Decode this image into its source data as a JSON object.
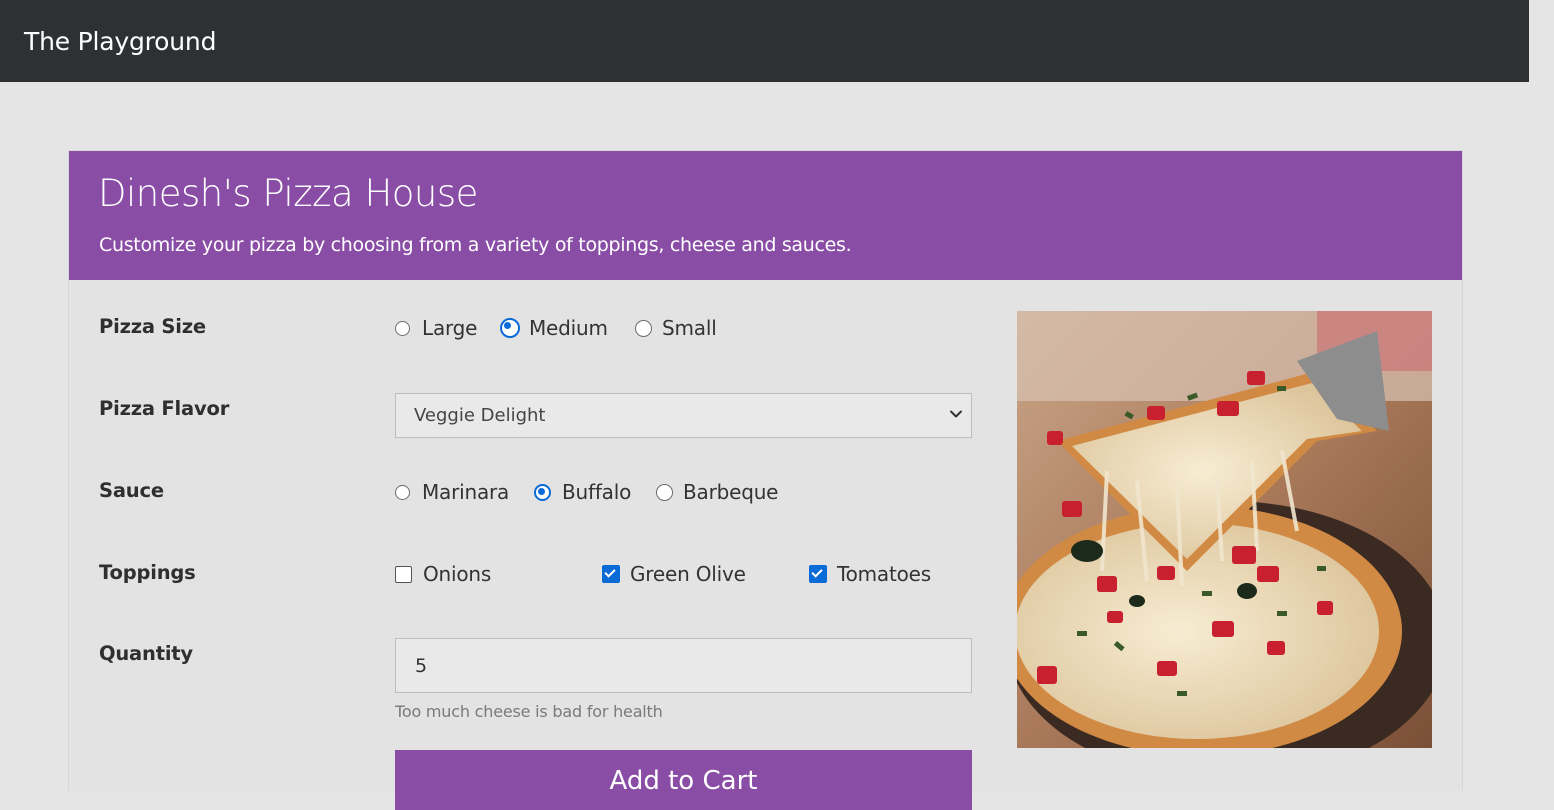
{
  "app": {
    "brand": "The Playground"
  },
  "header": {
    "title": "Dinesh's Pizza House",
    "subtitle": "Customize your pizza by choosing from a variety of toppings, cheese and sauces."
  },
  "form": {
    "size": {
      "label": "Pizza Size",
      "options": [
        {
          "label": "Large",
          "selected": false
        },
        {
          "label": "Medium",
          "selected": true
        },
        {
          "label": "Small",
          "selected": false
        }
      ]
    },
    "flavor": {
      "label": "Pizza Flavor",
      "value": "Veggie Delight"
    },
    "sauce": {
      "label": "Sauce",
      "options": [
        {
          "label": "Marinara",
          "selected": false
        },
        {
          "label": "Buffalo",
          "selected": true
        },
        {
          "label": "Barbeque",
          "selected": false
        }
      ]
    },
    "toppings": {
      "label": "Toppings",
      "options": [
        {
          "label": "Onions",
          "checked": false
        },
        {
          "label": "Green Olive",
          "checked": true
        },
        {
          "label": "Tomatoes",
          "checked": true
        }
      ]
    },
    "quantity": {
      "label": "Quantity",
      "value": "5",
      "hint": "Too much cheese is bad for health"
    },
    "submit_label": "Add to Cart"
  },
  "colors": {
    "navbar": "#2d3133",
    "accent": "#8a4da6",
    "control": "#0b6bd6"
  },
  "image": {
    "subject": "pizza-slice-photo"
  }
}
